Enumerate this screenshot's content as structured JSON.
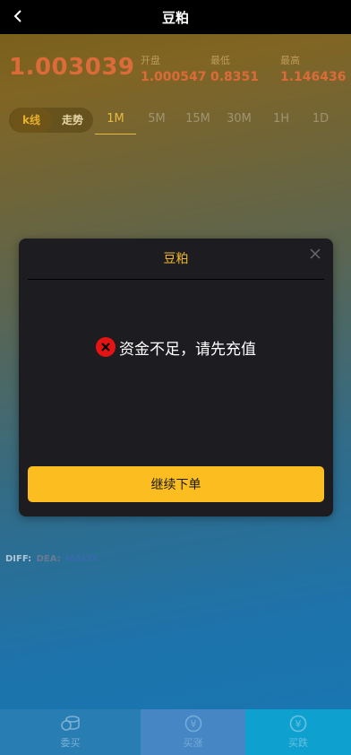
{
  "header": {
    "title": "豆粕",
    "back_icon": "chevron-left-icon"
  },
  "price": {
    "current": "1.003039",
    "stats": [
      {
        "label": "开盘",
        "value": "1.000547"
      },
      {
        "label": "最低",
        "value": "0.8351"
      },
      {
        "label": "最高",
        "value": "1.146436"
      }
    ]
  },
  "chart_tabs": {
    "segments": [
      {
        "label": "k线",
        "active": true
      },
      {
        "label": "走势",
        "active": false
      }
    ],
    "timeframes": [
      {
        "label": "1M",
        "active": true
      },
      {
        "label": "5M",
        "active": false
      },
      {
        "label": "15M",
        "active": false
      },
      {
        "label": "30M",
        "active": false
      },
      {
        "label": "1H",
        "active": false
      },
      {
        "label": "1D",
        "active": false
      }
    ]
  },
  "indicator": {
    "diff_label": "DIFF:",
    "dea_label": "DEA:",
    "macd_label": "MACD:"
  },
  "modal": {
    "title": "豆粕",
    "message": "资金不足，请先充值",
    "button_label": "继续下单",
    "close_icon": "close-icon",
    "error_icon": "error-x-icon"
  },
  "bottom_nav": [
    {
      "label": "委买",
      "icon": "coins-stack-icon"
    },
    {
      "label": "买涨",
      "icon": "yen-coin-icon"
    },
    {
      "label": "买跌",
      "icon": "yen-coin-icon"
    }
  ],
  "colors": {
    "accent_gold": "#f0b72e",
    "price_orange": "#e4703c",
    "button_yellow": "#fbbd1f",
    "error_red": "#e41414",
    "modal_bg": "#1d1c21"
  }
}
